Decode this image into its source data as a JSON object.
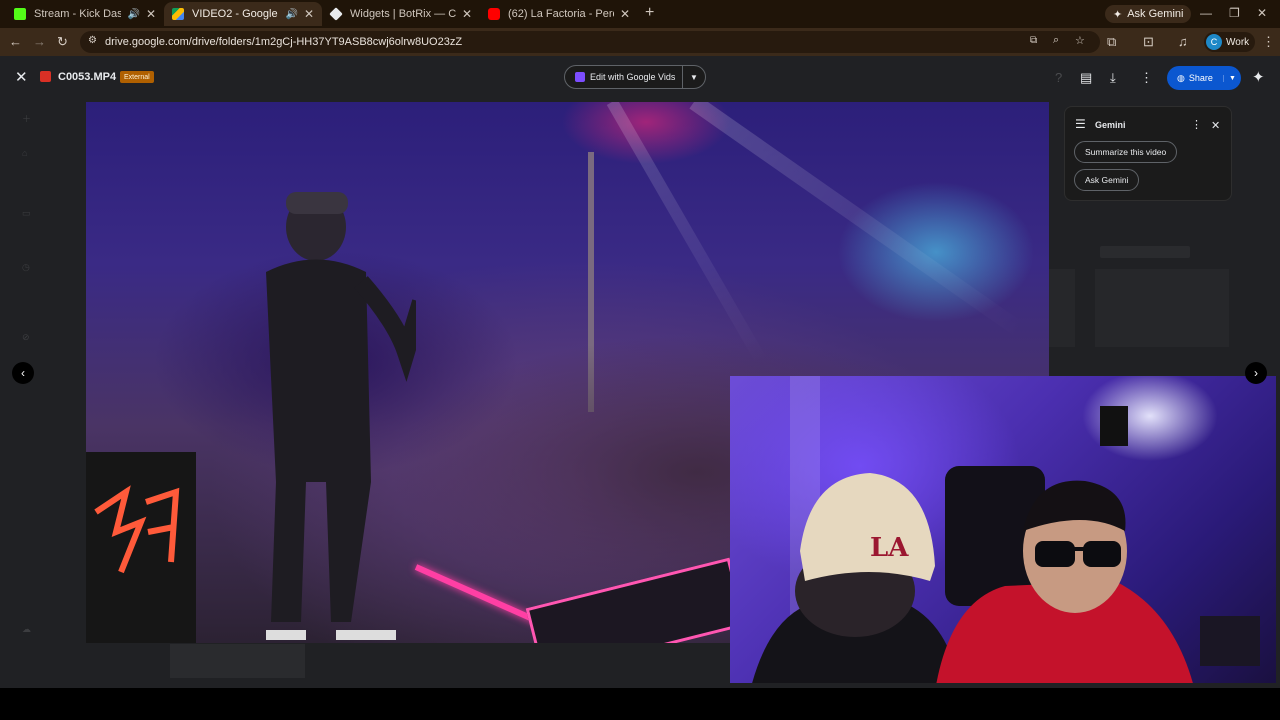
{
  "tabs": [
    {
      "title": "Stream - Kick Dashboard",
      "favicon_color": "#53fc18",
      "audio": true,
      "active": false
    },
    {
      "title": "VIDEO2 - Google Drive",
      "favicon_color": "#fbbc04",
      "audio": true,
      "active": true
    },
    {
      "title": "Widgets | BotRix — Cloud Strea",
      "favicon_color": "#e8eaed",
      "audio": false,
      "active": false
    },
    {
      "title": "(62) La Factoria - Perdoname ft",
      "favicon_color": "#ff0000",
      "audio": false,
      "active": false
    }
  ],
  "browser": {
    "ask_gemini": "Ask Gemini",
    "url": "drive.google.com/drive/folders/1m2gCj-HH37YT9ASB8cwj6olrw8UO23zZ",
    "profile_initial": "C",
    "profile_label": "Work"
  },
  "viewer": {
    "file_name": "C0053.MP4",
    "badge": "External",
    "edit_button": "Edit with Google Vids",
    "share_button": "Share"
  },
  "gemini_panel": {
    "title": "Gemini",
    "chips": [
      "Summarize this video",
      "Ask Gemini"
    ]
  },
  "icons": {
    "close": "close-icon",
    "prev": "chevron-left-icon",
    "next": "chevron-right-icon",
    "download": "download-icon",
    "comment": "add-comment-icon",
    "more": "more-vert-icon",
    "gemini": "gemini-spark-icon"
  }
}
